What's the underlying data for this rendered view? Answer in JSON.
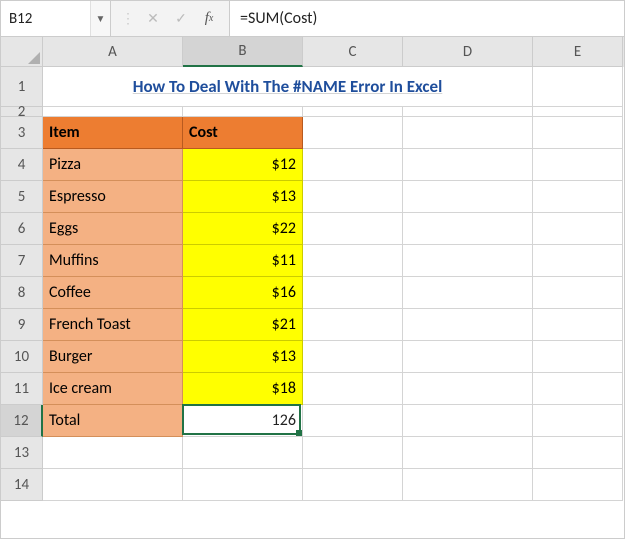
{
  "namebox": {
    "value": "B12"
  },
  "formula_bar": {
    "value": "=SUM(Cost)"
  },
  "columns": [
    "A",
    "B",
    "C",
    "D",
    "E"
  ],
  "active": {
    "col": "B",
    "row": 12
  },
  "title": "How To Deal With The #NAME Error In Excel",
  "headers": {
    "item": "Item",
    "cost": "Cost"
  },
  "rows": [
    {
      "item": "Pizza",
      "cost": "$12"
    },
    {
      "item": "Espresso",
      "cost": "$13"
    },
    {
      "item": "Eggs",
      "cost": "$22"
    },
    {
      "item": "Muffins",
      "cost": "$11"
    },
    {
      "item": "Coffee",
      "cost": "$16"
    },
    {
      "item": "French Toast",
      "cost": "$21"
    },
    {
      "item": "Burger",
      "cost": "$13"
    },
    {
      "item": "Ice cream",
      "cost": "$18"
    }
  ],
  "total": {
    "label": "Total",
    "value": "126"
  },
  "chart_data": {
    "type": "table",
    "title": "How To Deal With The #NAME Error In Excel",
    "columns": [
      "Item",
      "Cost"
    ],
    "rows": [
      [
        "Pizza",
        12
      ],
      [
        "Espresso",
        13
      ],
      [
        "Eggs",
        22
      ],
      [
        "Muffins",
        11
      ],
      [
        "Coffee",
        16
      ],
      [
        "French Toast",
        21
      ],
      [
        "Burger",
        13
      ],
      [
        "Ice cream",
        18
      ]
    ],
    "total": 126,
    "formula": "=SUM(Cost)"
  }
}
